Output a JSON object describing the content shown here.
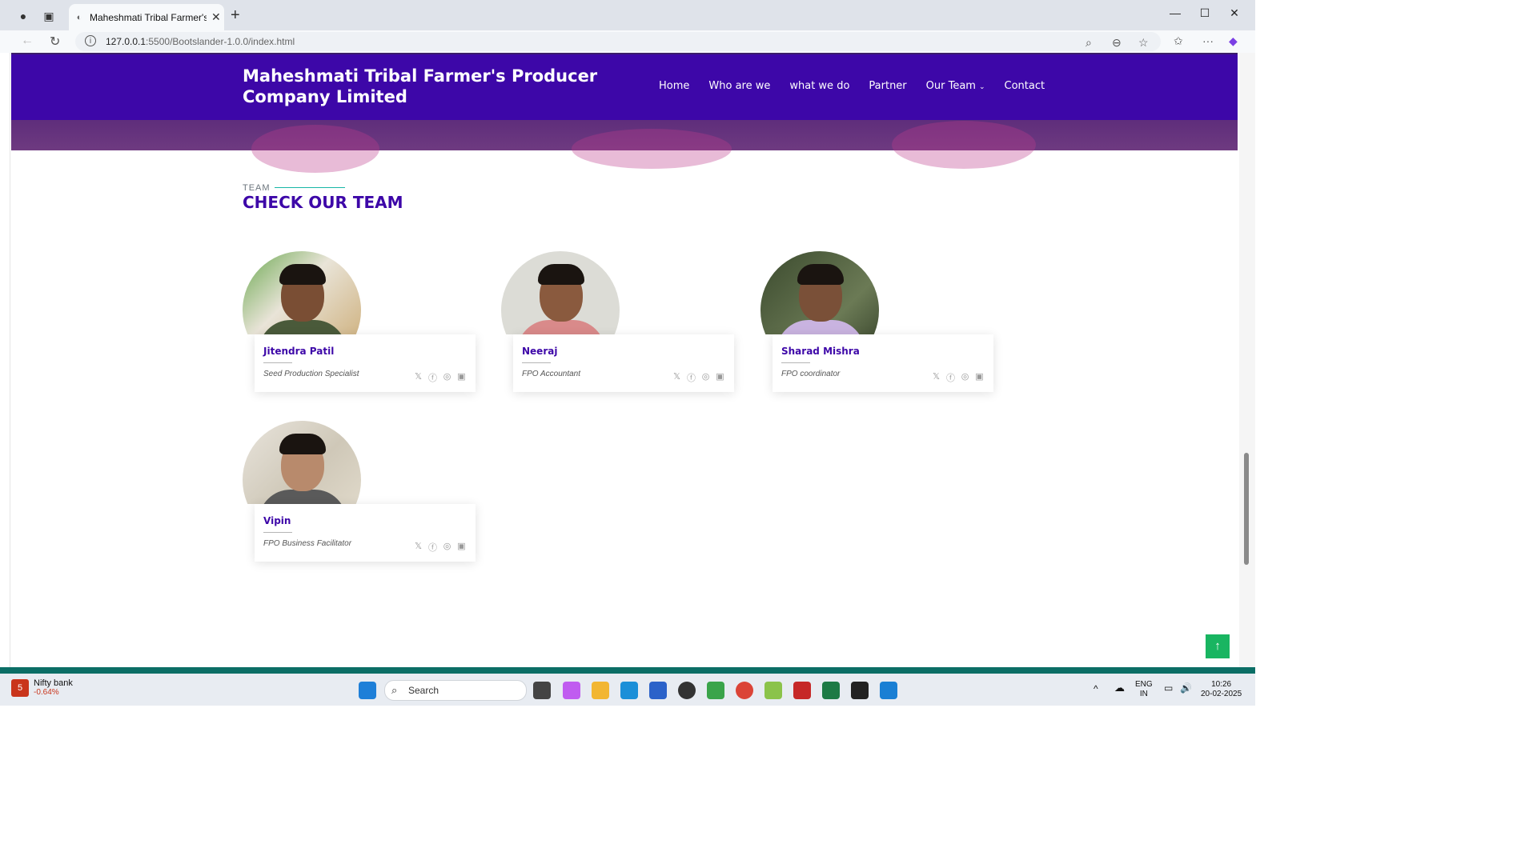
{
  "browser": {
    "tab_title": "Maheshmati Tribal Farmer's prod",
    "url_host": "127.0.0.1",
    "url_rest": ":5500/Bootslander-1.0.0/index.html"
  },
  "site": {
    "brand": "Maheshmati Tribal Farmer's Producer Company Limited",
    "nav": [
      "Home",
      "Who are we",
      "what we do",
      "Partner",
      "Our Team",
      "Contact"
    ]
  },
  "section": {
    "label": "TEAM",
    "title": "CHECK OUR TEAM"
  },
  "team": [
    {
      "name": "Jitendra Patil",
      "role": "Seed Production Specialist"
    },
    {
      "name": "Neeraj",
      "role": "FPO Accountant"
    },
    {
      "name": "Sharad Mishra",
      "role": "FPO coordinator"
    },
    {
      "name": "Vipin",
      "role": "FPO Business Facilitator"
    }
  ],
  "social_icons": [
    "x-icon",
    "facebook-icon",
    "instagram-icon",
    "linkedin-icon"
  ],
  "taskbar": {
    "ticker_name": "Nifty bank",
    "ticker_change": "-0.64%",
    "ticker_badge": "5",
    "search_label": "Search",
    "lang_top": "ENG",
    "lang_bottom": "IN",
    "time": "10:26",
    "date": "20-02-2025"
  },
  "colors": {
    "brand_purple": "#3d07a8",
    "accent_teal": "#17b7a6",
    "backtop_green": "#19b561"
  }
}
